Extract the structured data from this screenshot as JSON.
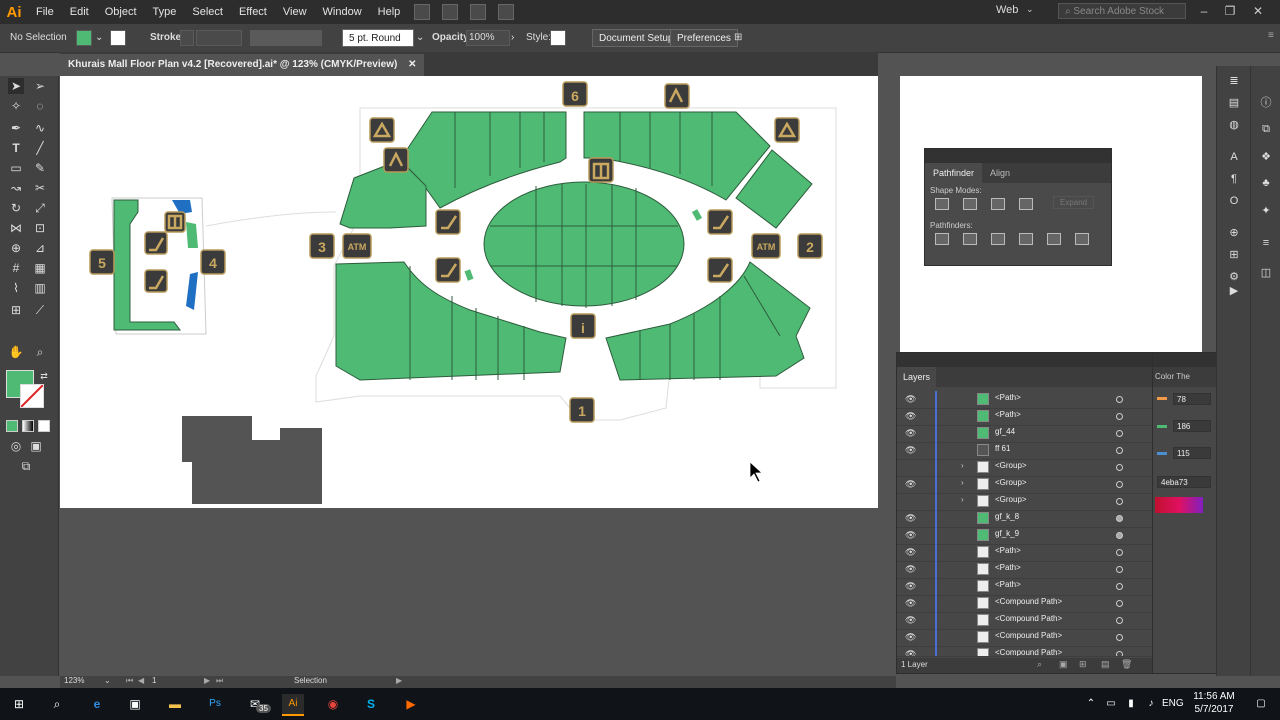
{
  "app": {
    "logo": "Ai"
  },
  "menubar": {
    "items": [
      "File",
      "Edit",
      "Object",
      "Type",
      "Select",
      "Effect",
      "View",
      "Window",
      "Help"
    ],
    "workspace": "Web",
    "search_placeholder": "Search Adobe Stock"
  },
  "control_bar": {
    "selection": "No Selection",
    "stroke_label": "Stroke:",
    "brush": "5 pt. Round",
    "opacity_label": "Opacity:",
    "opacity_value": "100%",
    "style_label": "Style:",
    "document_setup": "Document Setup",
    "preferences": "Preferences"
  },
  "document": {
    "tab_title": "Khurais Mall Floor Plan v4.2 [Recovered].ai* @ 123% (CMYK/Preview)"
  },
  "floorplan": {
    "entrances": [
      "1",
      "2",
      "3",
      "4",
      "5",
      "6"
    ],
    "atm_label": "ATM",
    "info_label": "i"
  },
  "pathfinder": {
    "tabs": [
      "Pathfinder",
      "Align"
    ],
    "shape_modes_label": "Shape Modes:",
    "expand_label": "Expand",
    "pathfinders_label": "Pathfinders:"
  },
  "layers": {
    "tab": "Layers",
    "rows": [
      "<Path>",
      "<Path>",
      "gf_44",
      "ff 61",
      "<Group>",
      "<Group>",
      "<Group>",
      "gf_k_8",
      "gf_k_9",
      "<Path>",
      "<Path>",
      "<Path>",
      "<Compound Path>",
      "<Compound Path>",
      "<Compound Path>",
      "<Compound Path>"
    ],
    "footer": "1 Layer"
  },
  "color_panel": {
    "tab": "Color The",
    "r": "78",
    "g": "186",
    "b": "115",
    "hex": "4eba73"
  },
  "colors": {
    "fill": "#4eba73",
    "accent_blue": "#4a6fd0"
  },
  "status": {
    "zoom": "123%",
    "artboard": "1",
    "tool": "Selection"
  },
  "taskbar": {
    "mail_badge": "35",
    "language": "ENG",
    "time": "11:56 AM",
    "date": "5/7/2017"
  }
}
